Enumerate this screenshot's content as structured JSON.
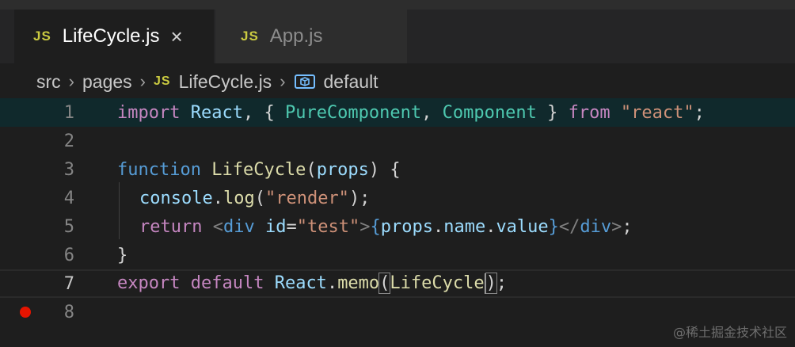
{
  "tabs": [
    {
      "icon": "JS",
      "label": "LifeCycle.js",
      "active": true,
      "close": "×"
    },
    {
      "icon": "JS",
      "label": "App.js",
      "active": false
    }
  ],
  "breadcrumb": {
    "items": [
      "src",
      "pages",
      "LifeCycle.js",
      "default"
    ],
    "file_icon": "JS",
    "separator": "›"
  },
  "editor": {
    "line_numbers": [
      "1",
      "2",
      "3",
      "4",
      "5",
      "6",
      "7",
      "8"
    ],
    "breakpoint_line": 8,
    "current_line": 7,
    "tokens": {
      "l1": [
        "import",
        " React",
        ", { ",
        "PureComponent",
        ", ",
        "Component",
        " } ",
        "from",
        " ",
        "\"react\"",
        ";"
      ],
      "l3": [
        "function",
        " ",
        "LifeCycle",
        "(",
        "props",
        ") {"
      ],
      "l4": [
        "console",
        ".",
        "log",
        "(",
        "\"render\"",
        ");"
      ],
      "l5": [
        "return",
        " ",
        "<",
        "div",
        " ",
        "id",
        "=",
        "\"test\"",
        ">",
        "{",
        "props",
        ".",
        "name",
        ".",
        "value",
        "}",
        "</",
        "div",
        ">",
        ";"
      ],
      "l6": [
        "}"
      ],
      "l7": [
        "export",
        " ",
        "default",
        " ",
        "React",
        ".",
        "memo",
        "(",
        "LifeCycle",
        ")",
        ";"
      ]
    }
  },
  "watermark": "@稀土掘金技术社区",
  "colors": {
    "keyword": "#c586c0",
    "storage": "#569cd6",
    "variable": "#9cdcfe",
    "class": "#4ec9b0",
    "function": "#dcdcaa",
    "string": "#ce9178",
    "breakpoint": "#e51400"
  }
}
